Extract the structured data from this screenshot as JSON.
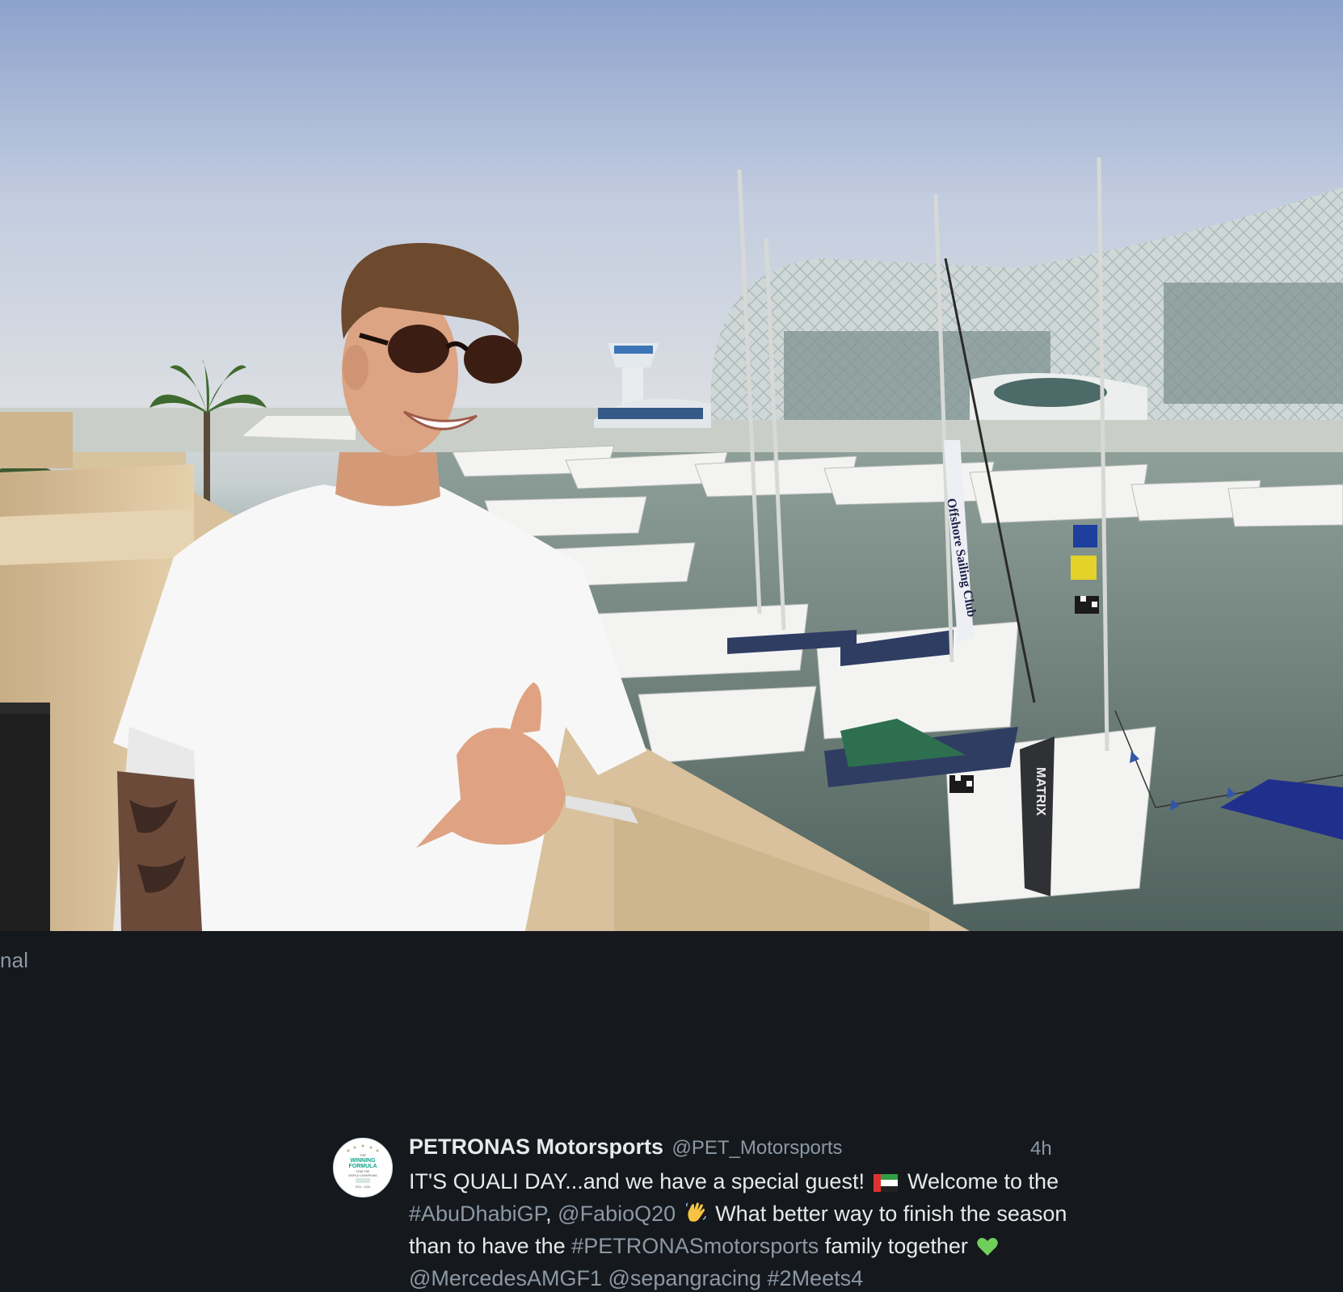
{
  "viewer": {
    "original_link_label": "inal"
  },
  "tweet": {
    "avatar": {
      "text_lines": [
        "THE",
        "WINNING",
        "FORMULA",
        "STAR THE",
        "WORLD CHAMPIONS",
        "2014 - 2024"
      ]
    },
    "display_name": "PETRONAS Motorsports",
    "handle": "@PET_Motorsports",
    "timestamp": "4h",
    "text": {
      "l1_a": "IT'S QUALI DAY...and we have a special guest!",
      "l1_flag_icon": "uae-flag-icon",
      "l1_b": "Welcome to the",
      "l2_hashtag1": "#AbuDhabiGP",
      "l2_sep": ",",
      "l2_mention1": "@FabioQ20",
      "l2_wave_icon": "waving-hand-icon",
      "l2_b": "What better way to finish the season",
      "l3_a": "than to have the",
      "l3_hashtag2": "#PETRONASmotorsports",
      "l3_b": "family together",
      "l3_heart_icon": "green-heart-icon",
      "l4_mention2": "@MercedesAMGF1",
      "l4_mention3": "@sepangracing",
      "l4_hashtag3": "#2Meets4"
    }
  },
  "photo": {
    "banner_text": "Offshore Sailing Club",
    "sail_flag_text": "MATRIX"
  },
  "colors": {
    "background": "#15181c",
    "primary_text": "#e7e9ea",
    "secondary_text": "#8b98a5",
    "heart_green": "#6fcf5b"
  }
}
